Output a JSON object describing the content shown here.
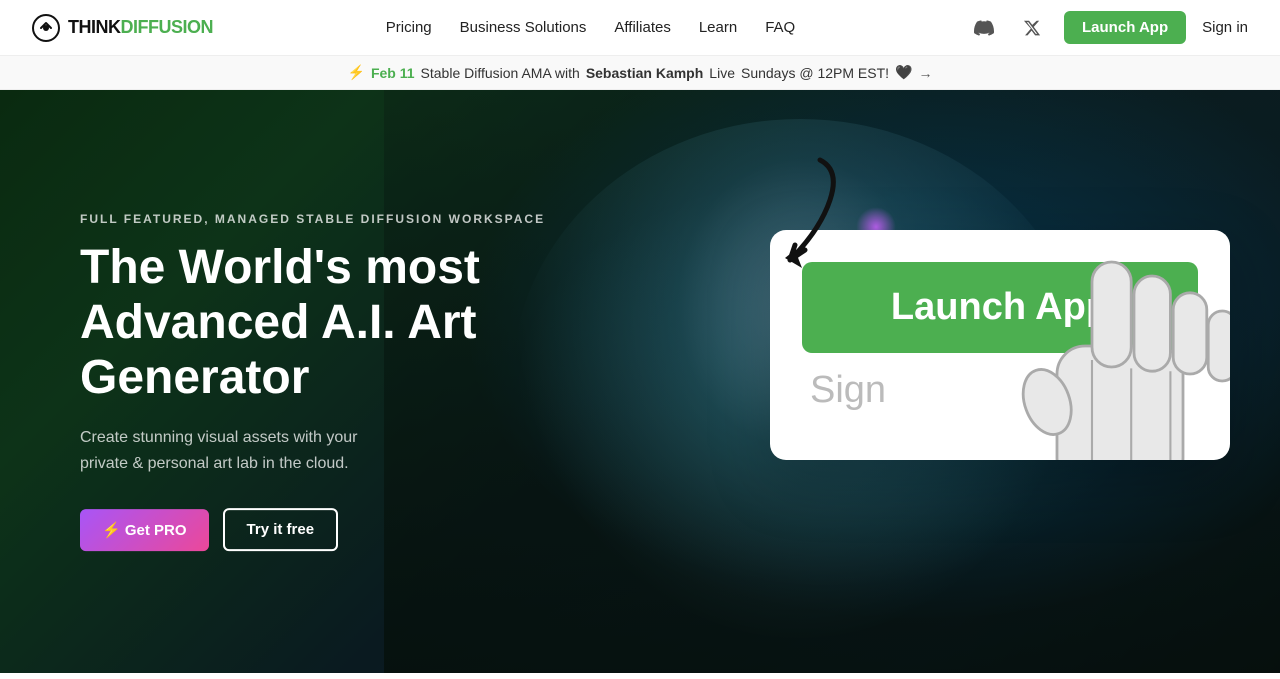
{
  "brand": {
    "name_part1": "THINK",
    "name_part2": "DIFFUSION"
  },
  "nav": {
    "links": [
      {
        "label": "Pricing",
        "id": "pricing"
      },
      {
        "label": "Business Solutions",
        "id": "business-solutions"
      },
      {
        "label": "Affiliates",
        "id": "affiliates"
      },
      {
        "label": "Learn",
        "id": "learn"
      },
      {
        "label": "FAQ",
        "id": "faq"
      }
    ],
    "launch_btn": "Launch App",
    "sign_in": "Sign in"
  },
  "announcement": {
    "bolt": "⚡",
    "date": "Feb 11",
    "text_before": "Stable Diffusion AMA with",
    "speaker": "Sebastian Kamph",
    "text_middle": "Live",
    "schedule": "Sundays @ 12PM EST!",
    "emoji": "🖤",
    "arrow": "→"
  },
  "hero": {
    "eyebrow": "FULL FEATURED, MANAGED STABLE DIFFUSION WORKSPACE",
    "title_line1": "The World's most",
    "title_line2": "Advanced A.I. Art",
    "title_line3": "Generator",
    "subtitle": "Create stunning visual assets with your\nprivate & personal art lab in the cloud.",
    "cta_pro": "⚡ Get PRO",
    "cta_free": "Try it free"
  },
  "tooltip_card": {
    "launch_label": "Launch App",
    "sign_label": "Sign"
  },
  "colors": {
    "launch_green": "#4caf50",
    "pro_gradient_from": "#a855f7",
    "pro_gradient_to": "#ec4899"
  }
}
